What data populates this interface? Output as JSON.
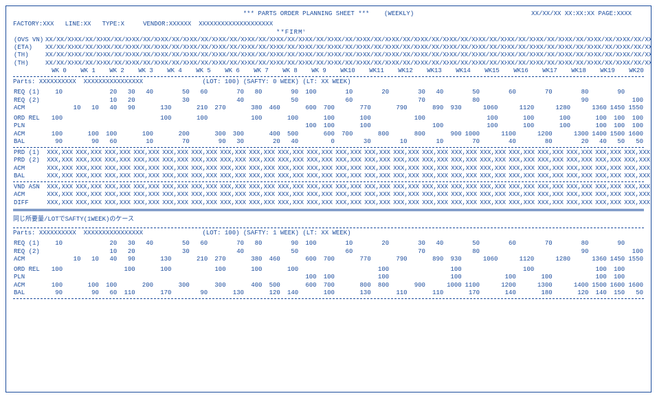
{
  "header": {
    "title": "*** PARTS ORDER PLANNING SHEET ***",
    "mode": "(WEEKLY)",
    "stamp": "XX/XX/XX  XX:XX:XX  PAGE:XXXX",
    "factory": "FACTORY:XXX",
    "line": "LINE:XX",
    "type": "TYPE:X",
    "vendor": "VENDOR:XXXXXX",
    "vendor_name": "XXXXXXXXXXXXXXXXXXXX",
    "firm_mark": "**FIRM**"
  },
  "ovs": {
    "ovs_lbl": "(OVS VN)",
    "eta_lbl": "(ETA)",
    "th1_lbl": "(TH)",
    "th2_lbl": "(TH)",
    "date_ph": "XX/XX/XX",
    "weeks": [
      "WK 0",
      "WK 1",
      "WK 2",
      "WK 3",
      "WK 4",
      "WK 5",
      "WK 6",
      "WK 7",
      "WK 8",
      "WK 9",
      "WK10",
      "WK11",
      "WK12",
      "WK13",
      "WK14",
      "WK15",
      "WK16",
      "WK17",
      "WK18",
      "WK19",
      "WK20"
    ]
  },
  "case1": {
    "parts_lbl": "Parts:",
    "parts_code": "XXXXXXXXXX",
    "parts_name": "XXXXXXXXXXXXXXXX",
    "lot": "(LOT:  100)",
    "safty": "(SAFTY: 0 WEEK)",
    "lt": "(LT: XX WEEK)",
    "rows": {
      "req1": {
        "lbl": "REQ (1)",
        "v": [
          "10",
          "",
          "",
          "20",
          "30",
          "40",
          "",
          "50",
          "60",
          "",
          "70",
          "80",
          "",
          "90",
          "100",
          "",
          "10",
          "",
          "20",
          "",
          "30",
          "40",
          "",
          "50",
          "",
          "60",
          "",
          "70",
          "",
          "80",
          "",
          "90",
          ""
        ]
      },
      "req2": {
        "lbl": "REQ (2)",
        "v": [
          "",
          "",
          "",
          "10",
          "20",
          "",
          "",
          "30",
          "",
          "",
          "40",
          "",
          "",
          "50",
          "",
          "",
          "60",
          "",
          "",
          "",
          "70",
          "",
          "",
          "80",
          "",
          "",
          "",
          "",
          "",
          "90",
          "",
          "",
          "100"
        ]
      },
      "acm": {
        "lbl": "ACM",
        "v": [
          "",
          "10",
          "10",
          "40",
          "90",
          "",
          "130",
          "",
          "210",
          "270",
          "",
          "380",
          "460",
          "",
          "600",
          "700",
          "",
          "770",
          "",
          "790",
          "",
          "890",
          "930",
          "",
          "1060",
          "",
          "1120",
          "",
          "1280",
          "",
          "1360",
          "1450",
          "1550"
        ]
      },
      "ord_rel": {
        "lbl": "ORD REL",
        "v": [
          "100",
          "",
          "",
          "",
          "",
          "",
          "100",
          "",
          "100",
          "",
          "",
          "100",
          "",
          "100",
          "",
          "100",
          "",
          "100",
          "",
          "",
          "100",
          "",
          "",
          "",
          "100",
          "",
          "100",
          "",
          "100",
          "",
          "100",
          "100",
          "100"
        ]
      },
      "pln": {
        "lbl": "PLN",
        "v": [
          "",
          "",
          "",
          "",
          "",
          "",
          "",
          "",
          "",
          "",
          "",
          "",
          "",
          "",
          "100",
          "100",
          "",
          "100",
          "",
          "",
          "",
          "100",
          "",
          "",
          "100",
          "",
          "100",
          "",
          "100",
          "",
          "100",
          "100",
          "100"
        ]
      },
      "acm2": {
        "lbl": "ACM",
        "v": [
          "100",
          "",
          "100",
          "100",
          "",
          "100",
          "",
          "200",
          "",
          "300",
          "300",
          "",
          "400",
          "500",
          "",
          "600",
          "700",
          "",
          "800",
          "",
          "800",
          "",
          "900",
          "1000",
          "",
          "1100",
          "",
          "1200",
          "",
          "1300",
          "1400",
          "1500",
          "1600"
        ]
      },
      "bal": {
        "lbl": "BAL",
        "v": [
          "90",
          "",
          "90",
          "60",
          "",
          "10",
          "",
          "70",
          "",
          "90",
          "30",
          "",
          "20",
          "40",
          "",
          "0",
          "",
          "30",
          "",
          "10",
          "",
          "10",
          "",
          "70",
          "",
          "40",
          "",
          "80",
          "",
          "20",
          "40",
          "50",
          "50"
        ]
      }
    }
  },
  "xxxblock": {
    "prd1": "PRD (1)",
    "prd2": "PRD (2)",
    "acm": "ACM",
    "bal": "BAL",
    "vnd_asn": "VND ASN",
    "acm2": "ACM",
    "diff": "DIFF",
    "ph": "XXX,XXX"
  },
  "case2_note": "同じ所要量/LOTでSAFTY(1WEEK)のケース",
  "case2": {
    "parts_lbl": "Parts:",
    "parts_code": "XXXXXXXXXX",
    "parts_name": "XXXXXXXXXXXXXXXX",
    "lot": "(LOT:  100)",
    "safty": "(SAFTY: 1 WEEK)",
    "lt": "(LT: XX WEEK)",
    "rows": {
      "req1": {
        "lbl": "REQ (1)",
        "v": [
          "10",
          "",
          "",
          "20",
          "30",
          "40",
          "",
          "50",
          "60",
          "",
          "70",
          "80",
          "",
          "90",
          "100",
          "",
          "10",
          "",
          "20",
          "",
          "30",
          "40",
          "",
          "50",
          "",
          "60",
          "",
          "70",
          "",
          "80",
          "",
          "90",
          ""
        ]
      },
      "req2": {
        "lbl": "REQ (2)",
        "v": [
          "",
          "",
          "",
          "10",
          "20",
          "",
          "",
          "30",
          "",
          "",
          "40",
          "",
          "",
          "50",
          "",
          "",
          "60",
          "",
          "",
          "",
          "70",
          "",
          "",
          "80",
          "",
          "",
          "",
          "",
          "",
          "90",
          "",
          "",
          "100"
        ]
      },
      "acm": {
        "lbl": "ACM",
        "v": [
          "",
          "10",
          "10",
          "40",
          "90",
          "",
          "130",
          "",
          "210",
          "270",
          "",
          "380",
          "460",
          "",
          "600",
          "700",
          "",
          "770",
          "",
          "790",
          "",
          "890",
          "930",
          "",
          "1060",
          "",
          "1120",
          "",
          "1280",
          "",
          "1360",
          "1450",
          "1550"
        ]
      },
      "ord_rel": {
        "lbl": "ORD REL",
        "v": [
          "100",
          "",
          "",
          "",
          "100",
          "",
          "100",
          "",
          "",
          "100",
          "",
          "100",
          "",
          "100",
          "",
          "",
          "",
          "",
          "100",
          "",
          "",
          "",
          "100",
          "",
          "",
          "",
          "100",
          "",
          "",
          "",
          "100",
          "100",
          ""
        ]
      },
      "pln": {
        "lbl": "PLN",
        "v": [
          "",
          "",
          "",
          "",
          "",
          "",
          "",
          "",
          "",
          "",
          "",
          "",
          "",
          "",
          "100",
          "100",
          "",
          "",
          "100",
          "",
          "",
          "",
          "100",
          "",
          "",
          "100",
          "",
          "100",
          "",
          "",
          "100",
          "100",
          ""
        ]
      },
      "acm2": {
        "lbl": "ACM",
        "v": [
          "100",
          "",
          "100",
          "100",
          "",
          "200",
          "",
          "300",
          "",
          "300",
          "",
          "400",
          "500",
          "",
          "600",
          "700",
          "",
          "800",
          "800",
          "",
          "900",
          "",
          "1000",
          "1100",
          "",
          "1200",
          "",
          "1300",
          "",
          "1400",
          "1500",
          "1600",
          "1600"
        ]
      },
      "bal": {
        "lbl": "BAL",
        "v": [
          "90",
          "",
          "90",
          "60",
          "110",
          "",
          "170",
          "",
          "90",
          "",
          "130",
          "",
          "120",
          "140",
          "",
          "100",
          "",
          "130",
          "",
          "110",
          "",
          "110",
          "",
          "170",
          "",
          "140",
          "",
          "180",
          "",
          "120",
          "140",
          "150",
          "50"
        ]
      }
    }
  }
}
